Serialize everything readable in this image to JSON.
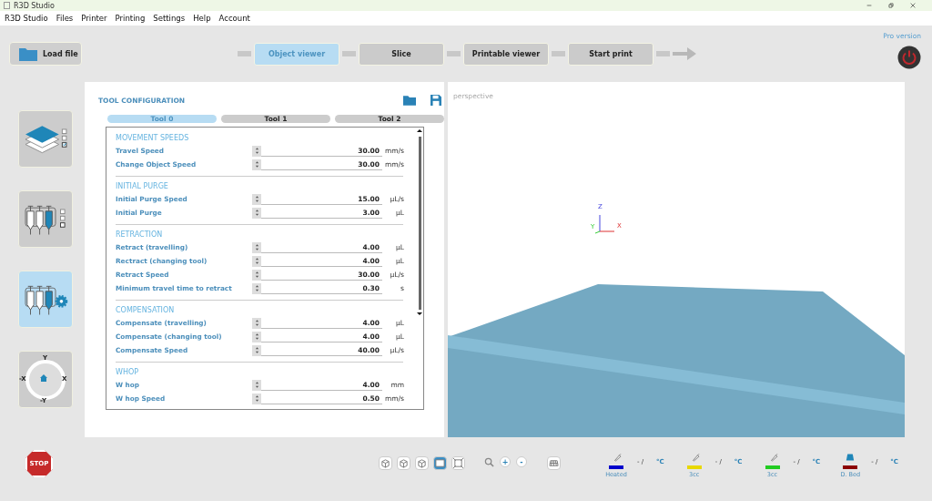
{
  "window": {
    "title": "R3D Studio"
  },
  "menu": [
    "R3D Studio",
    "Files",
    "Printer",
    "Printing",
    "Settings",
    "Help",
    "Account"
  ],
  "load_button": "Load file",
  "pro_link": "Pro version",
  "pipeline": [
    {
      "label": "Object viewer",
      "selected": true
    },
    {
      "label": "Slice",
      "selected": false
    },
    {
      "label": "Printable viewer",
      "selected": false
    },
    {
      "label": "Start print",
      "selected": false
    }
  ],
  "sidebar": [
    {
      "kind": "layers",
      "selected": false
    },
    {
      "kind": "syringes",
      "selected": false
    },
    {
      "kind": "syringe-settings",
      "selected": true
    },
    {
      "kind": "jog",
      "selected": false,
      "labels": [
        "Y",
        "-X",
        "X",
        "-Y"
      ]
    }
  ],
  "config": {
    "title": "TOOL CONFIGURATION",
    "tabs": [
      {
        "label": "Tool 0",
        "selected": true
      },
      {
        "label": "Tool 1",
        "selected": false
      },
      {
        "label": "Tool 2",
        "selected": false
      }
    ],
    "sections": [
      {
        "title": "MOVEMENT SPEEDS",
        "rows": [
          {
            "label": "Travel Speed",
            "value": "30.00",
            "unit": "mm/s"
          },
          {
            "label": "Change Object Speed",
            "value": "30.00",
            "unit": "mm/s"
          }
        ]
      },
      {
        "title": "INITIAL PURGE",
        "rows": [
          {
            "label": "Initial Purge Speed",
            "value": "15.00",
            "unit": "µL/s"
          },
          {
            "label": "Initial Purge",
            "value": "3.00",
            "unit": "µL"
          }
        ]
      },
      {
        "title": "RETRACTION",
        "rows": [
          {
            "label": "Retract (travelling)",
            "value": "4.00",
            "unit": "µL"
          },
          {
            "label": "Rectract (changing tool)",
            "value": "4.00",
            "unit": "µL"
          },
          {
            "label": "Retract Speed",
            "value": "30.00",
            "unit": "µL/s"
          },
          {
            "label": "Minimum travel time to retract",
            "value": "0.30",
            "unit": "s"
          }
        ]
      },
      {
        "title": "COMPENSATION",
        "rows": [
          {
            "label": "Compensate (travelling)",
            "value": "4.00",
            "unit": "µL"
          },
          {
            "label": "Compensate (changing tool)",
            "value": "4.00",
            "unit": "µL"
          },
          {
            "label": "Compensate Speed",
            "value": "40.00",
            "unit": "µL/s"
          }
        ]
      },
      {
        "title": "WHOP",
        "rows": [
          {
            "label": "W hop",
            "value": "4.00",
            "unit": "mm"
          },
          {
            "label": "W hop Speed",
            "value": "0.50",
            "unit": "mm/s"
          }
        ]
      }
    ]
  },
  "viewer": {
    "mode": "perspective",
    "axes": {
      "x": "X",
      "y": "Y",
      "z": "Z"
    }
  },
  "view_buttons": [
    {
      "kind": "iso",
      "selected": false
    },
    {
      "kind": "front",
      "selected": false
    },
    {
      "kind": "top",
      "selected": false
    },
    {
      "kind": "side",
      "selected": true
    },
    {
      "kind": "fit",
      "selected": false
    }
  ],
  "zoom_buttons": [
    "+",
    "-"
  ],
  "heaters": [
    {
      "kind": "syringe",
      "label": "Heated",
      "reading": "- /",
      "unit": "°C",
      "color": "#0000cc"
    },
    {
      "kind": "syringe",
      "label": "3cc",
      "reading": "- /",
      "unit": "°C",
      "color": "#e8d800"
    },
    {
      "kind": "syringe",
      "label": "3cc",
      "reading": "- /",
      "unit": "°C",
      "color": "#22cc22"
    },
    {
      "kind": "bed",
      "label": "D. Bed",
      "reading": "- /",
      "unit": "°C",
      "color": "#8b0000"
    }
  ],
  "stop_button": "STOP"
}
